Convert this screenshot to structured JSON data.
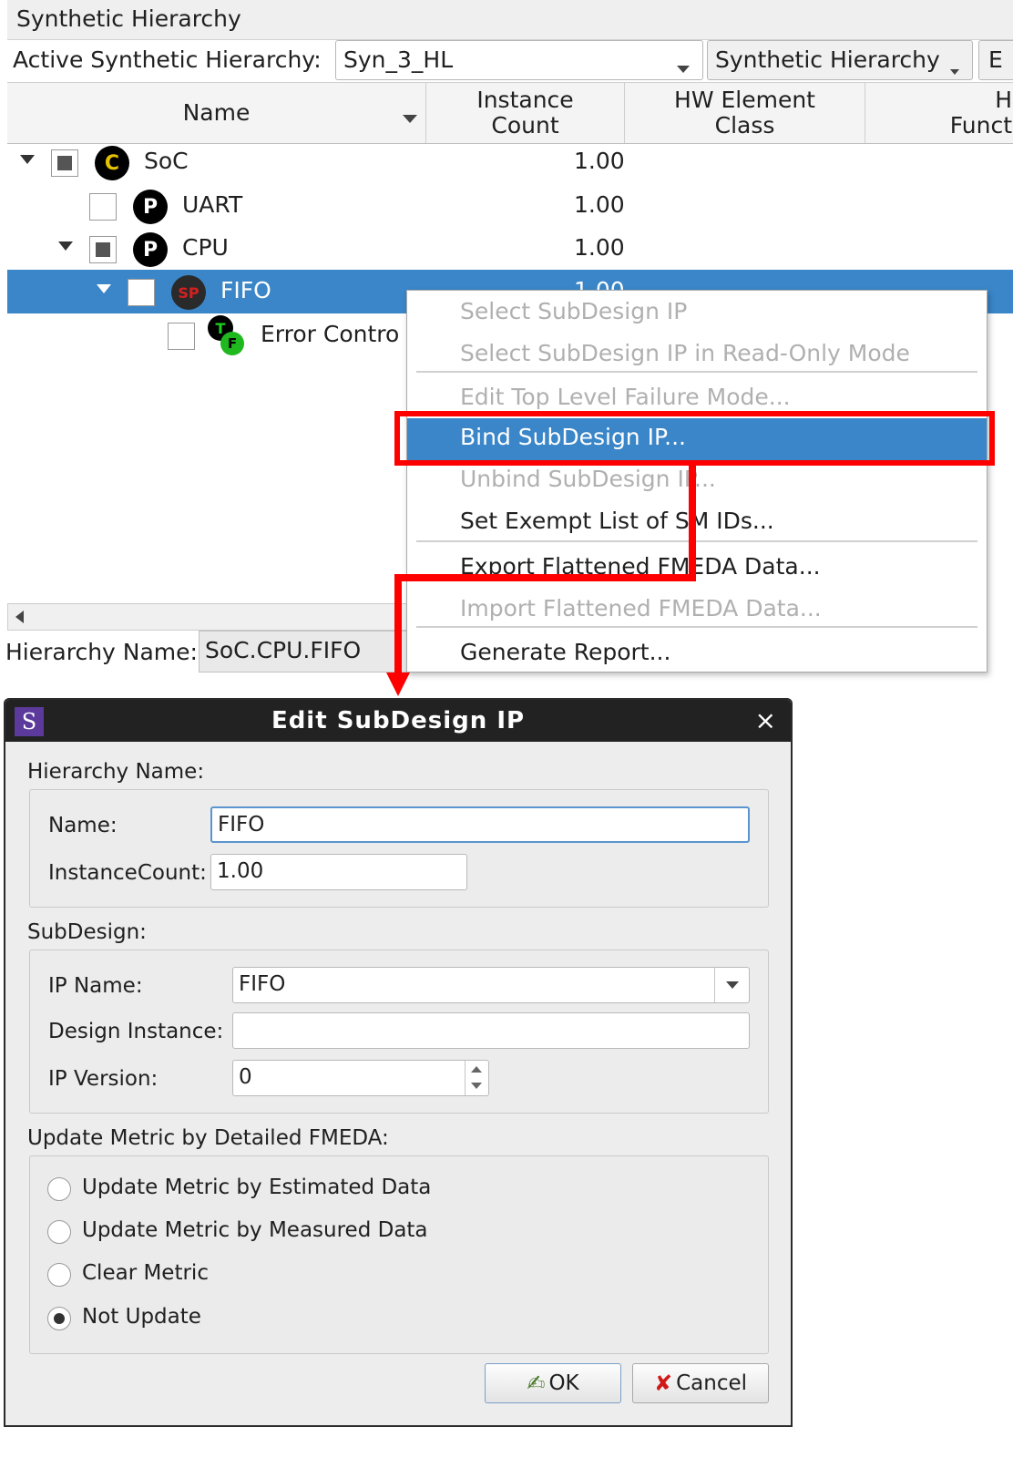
{
  "panel": {
    "title": "Synthetic Hierarchy",
    "active_label": "Active Synthetic Hierarchy:",
    "hierarchy_value": "Syn_3_HL",
    "type_value": "Synthetic Hierarchy",
    "extra_button": "E",
    "columns": [
      "Name",
      "Instance\nCount",
      "HW Element\nClass",
      "H\nFunct"
    ],
    "rows": [
      {
        "name": "SoC",
        "count": "1.00",
        "badge": "C"
      },
      {
        "name": "UART",
        "count": "1.00",
        "badge": "P"
      },
      {
        "name": "CPU",
        "count": "1.00",
        "badge": "P"
      },
      {
        "name": "FIFO",
        "count": "1.00",
        "badge": "SP"
      },
      {
        "name": "Error Contro",
        "count": "",
        "badge_top": "T",
        "badge_bottom": "F"
      }
    ],
    "hierarchy_name_label": "Hierarchy Name:",
    "hierarchy_name_value": "SoC.CPU.FIFO"
  },
  "menu": {
    "items": [
      {
        "label": "Select SubDesign IP",
        "enabled": false
      },
      {
        "label": "Select SubDesign IP in Read-Only Mode",
        "enabled": false
      },
      {
        "label": "Edit Top Level Failure Mode...",
        "enabled": false
      },
      {
        "label": "Bind SubDesign IP...",
        "enabled": true,
        "highlighted": true
      },
      {
        "label": "Unbind SubDesign IP...",
        "enabled": false
      },
      {
        "label": "Set Exempt List of SM IDs...",
        "enabled": true
      },
      {
        "label": "Export Flattened FMEDA Data...",
        "enabled": true
      },
      {
        "label": "Import Flattened FMEDA Data...",
        "enabled": false
      },
      {
        "label": "Generate Report...",
        "enabled": true
      }
    ]
  },
  "dialog": {
    "logo": "S",
    "title": "Edit SubDesign IP",
    "close": "×",
    "hierarchy_section": "Hierarchy Name:",
    "name_label": "Name:",
    "name_value": "FIFO",
    "instance_label": "InstanceCount:",
    "instance_value": "1.00",
    "subdesign_section": "SubDesign:",
    "ip_name_label": "IP Name:",
    "ip_name_value": "FIFO",
    "design_instance_label": "Design Instance:",
    "design_instance_value": "",
    "ip_version_label": "IP Version:",
    "ip_version_value": "0",
    "metric_section": "Update Metric by Detailed FMEDA:",
    "radio_options": [
      {
        "label": "Update Metric by Estimated Data",
        "checked": false
      },
      {
        "label": "Update Metric by Measured Data",
        "checked": false
      },
      {
        "label": "Clear Metric",
        "checked": false
      },
      {
        "label": "Not Update",
        "checked": true
      }
    ],
    "ok_label": "OK",
    "cancel_label": "Cancel"
  },
  "colors": {
    "selection": "#3a86c8",
    "annotation": "#ff0000",
    "titlebar": "#222222"
  }
}
